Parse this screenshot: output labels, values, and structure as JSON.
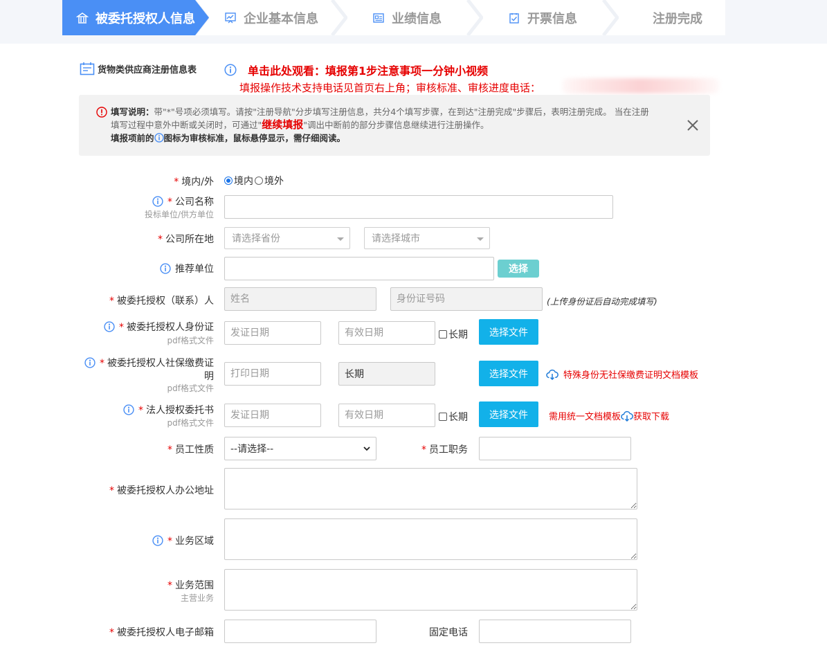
{
  "steps": [
    {
      "label": "被委托授权人信息",
      "icon": "bank-icon",
      "active": true
    },
    {
      "label": "企业基本信息",
      "icon": "chart-board-icon"
    },
    {
      "label": "业绩信息",
      "icon": "id-card-icon"
    },
    {
      "label": "开票信息",
      "icon": "checkbox-doc-icon"
    },
    {
      "label": "注册完成"
    }
  ],
  "header": {
    "title": "货物类供应商注册信息表",
    "video_link": "单击此处观看：填报第1步注意事项一分钟小视频",
    "support": "填报操作技术支持电话见首页右上角；审核标准、审核进度电话："
  },
  "instructions": {
    "label": "填写说明：",
    "line1": "带\"*\"号项必须填写。请按\"注册导航\"分步填写注册信息，共分4个填写步骤，在到达\"注册完成\"步骤后，表明注册完成。 当在注册",
    "line2a": "填写过程中意外中断或关闭时，可通过\"",
    "continue": "继续填报",
    "line2b": "\"调出中断前的部分步骤信息继续进行注册操作。",
    "line3a": "填报项前的",
    "line3b": "图标为审核标准，鼠标悬停显示，需仔细阅读。"
  },
  "form": {
    "location": {
      "label": "境内/外",
      "options": [
        "境内",
        "境外"
      ],
      "selected": "境内"
    },
    "company": {
      "label": "公司名称",
      "sub": "投标单位/供方单位",
      "value": ""
    },
    "address": {
      "label": "公司所在地",
      "province_placeholder": "请选择省份",
      "city_placeholder": "请选择城市"
    },
    "recommend": {
      "label": "推荐单位",
      "button": "选择"
    },
    "contact": {
      "label": "被委托授权（联系）人",
      "name_placeholder": "姓名",
      "id_placeholder": "身份证号码",
      "hint": "(上传身份证后自动完成填写)"
    },
    "idcard": {
      "label": "被委托授权人身份证",
      "sub": "pdf格式文件",
      "issue_placeholder": "发证日期",
      "expiry_placeholder": "有效日期",
      "longterm": "长期",
      "button": "选择文件"
    },
    "social": {
      "label_line1": "被委托授权人社保缴费证",
      "label_line2": "明",
      "sub": "pdf格式文件",
      "print_placeholder": "打印日期",
      "longterm_value": "长期",
      "button": "选择文件",
      "link": "特殊身份无社保缴费证明文档模板"
    },
    "authletter": {
      "label": "法人授权委托书",
      "sub": "pdf格式文件",
      "issue_placeholder": "发证日期",
      "expiry_placeholder": "有效日期",
      "longterm": "长期",
      "button": "选择文件",
      "link_prefix": "需用统一文档模板",
      "link_download": "获取下载"
    },
    "employee_type": {
      "label": "员工性质",
      "selected": "--请选择--"
    },
    "position": {
      "label": "员工职务"
    },
    "office": {
      "label": "被委托授权人办公地址"
    },
    "region": {
      "label": "业务区域"
    },
    "scope": {
      "label": "业务范围",
      "sub": "主营业务"
    },
    "email": {
      "label": "被委托授权人电子邮箱"
    },
    "phone": {
      "label": "固定电话"
    }
  },
  "colors": {
    "accent": "#4a8ff5",
    "required": "#e60000",
    "file_button": "#12b1e9",
    "select_button": "#6ccfd0"
  }
}
